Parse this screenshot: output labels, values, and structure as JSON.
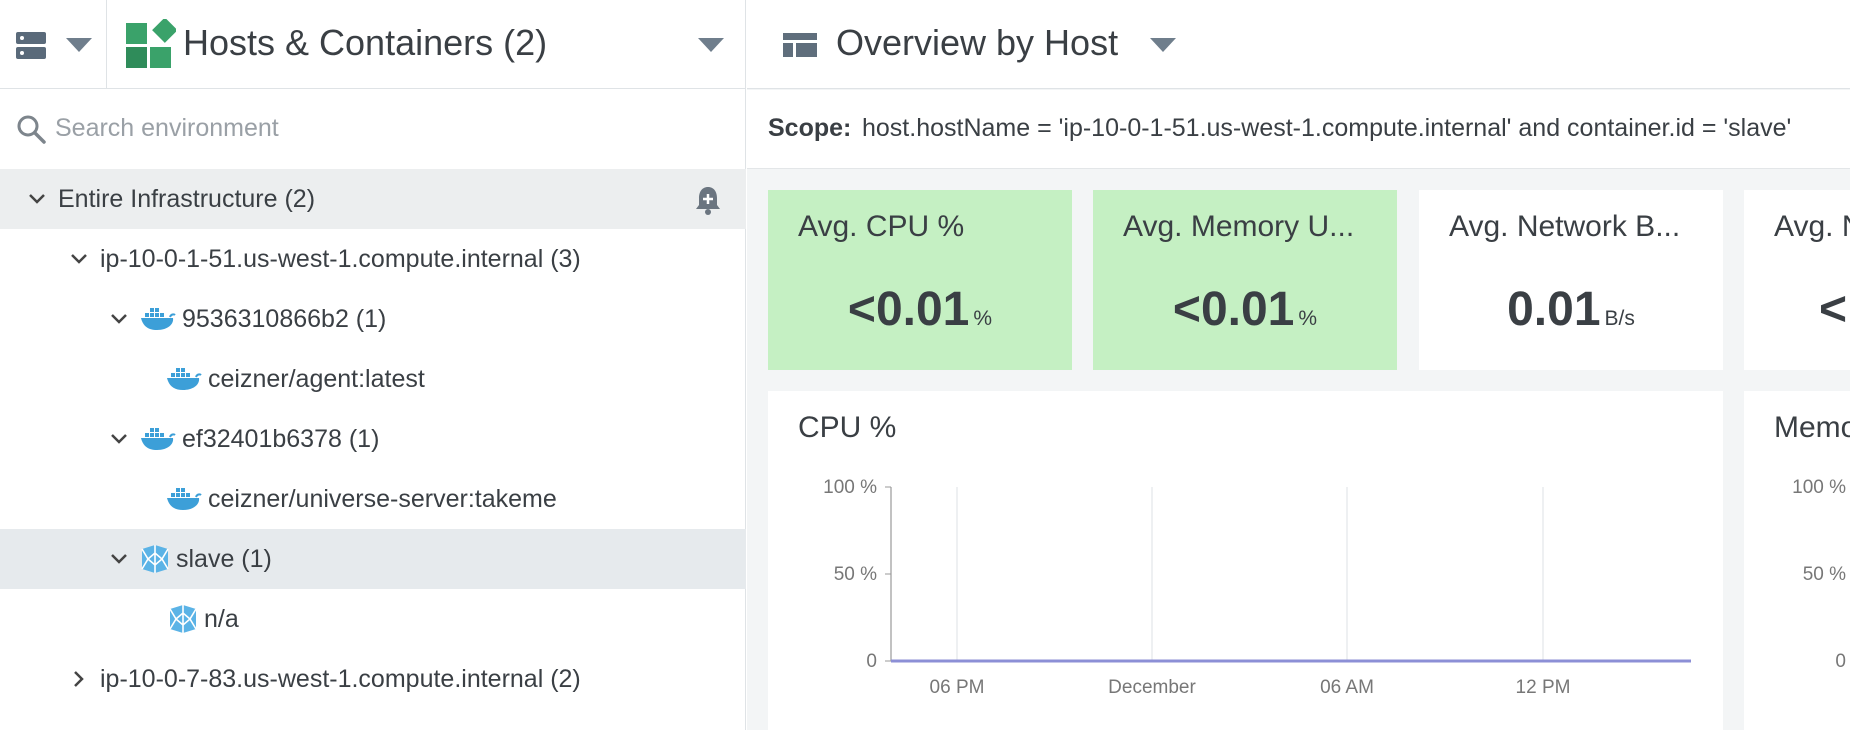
{
  "left_header": {
    "grouping_title": "Hosts & Containers (2)"
  },
  "search": {
    "placeholder": "Search environment"
  },
  "tree": {
    "root": {
      "label": "Entire Infrastructure (2)"
    },
    "items": [
      {
        "label": "ip-10-0-1-51.us-west-1.compute.internal (3)",
        "icon": "none",
        "expanded": true
      },
      {
        "label": "9536310866b2 (1)",
        "icon": "docker-icon",
        "expanded": true
      },
      {
        "label": "ceizner/agent:latest",
        "icon": "docker-icon"
      },
      {
        "label": "ef32401b6378 (1)",
        "icon": "docker-icon",
        "expanded": true
      },
      {
        "label": "ceizner/universe-server:takeme",
        "icon": "docker-icon"
      },
      {
        "label": "slave (1)",
        "icon": "mesos-icon",
        "expanded": true,
        "selected": true
      },
      {
        "label": "n/a",
        "icon": "mesos-icon"
      },
      {
        "label": "ip-10-0-7-83.us-west-1.compute.internal (2)",
        "icon": "none",
        "expanded": false
      }
    ]
  },
  "dashboard": {
    "title": "Overview by Host",
    "scope_label": "Scope:",
    "scope_value": "host.hostName = 'ip-10-0-1-51.us-west-1.compute.internal' and container.id = 'slave'"
  },
  "tiles": [
    {
      "title": "Avg. CPU %",
      "value": "<0.01",
      "unit": "%",
      "status": "ok"
    },
    {
      "title": "Avg. Memory U...",
      "value": "<0.01",
      "unit": "%",
      "status": "ok"
    },
    {
      "title": "Avg. Network B...",
      "value": "0.01",
      "unit": "B/s",
      "status": "neutral"
    },
    {
      "title": "Avg. N",
      "value": "<",
      "unit": "",
      "status": "neutral"
    }
  ],
  "panels": [
    {
      "title": "CPU %"
    },
    {
      "title": "Memo"
    }
  ],
  "colors": {
    "ok_tile": "#c5f0c3",
    "series_line": "#8c8fd6",
    "docker_blue": "#3c9fd8",
    "brand_green": "#3aa26a"
  },
  "chart_data": [
    {
      "type": "line",
      "title": "CPU %",
      "x": [
        "06 PM",
        "December",
        "06 AM",
        "12 PM"
      ],
      "yticks": [
        "100 %",
        "50 %",
        "0"
      ],
      "ylim": [
        0,
        100
      ],
      "grid": true,
      "series": [
        {
          "values": [
            0,
            0,
            0,
            0,
            0
          ]
        }
      ]
    },
    {
      "type": "line",
      "title": "Memo",
      "x": [],
      "yticks": [
        "100 %",
        "50 %",
        "0"
      ],
      "ylim": [
        0,
        100
      ],
      "grid": false,
      "series": []
    }
  ]
}
